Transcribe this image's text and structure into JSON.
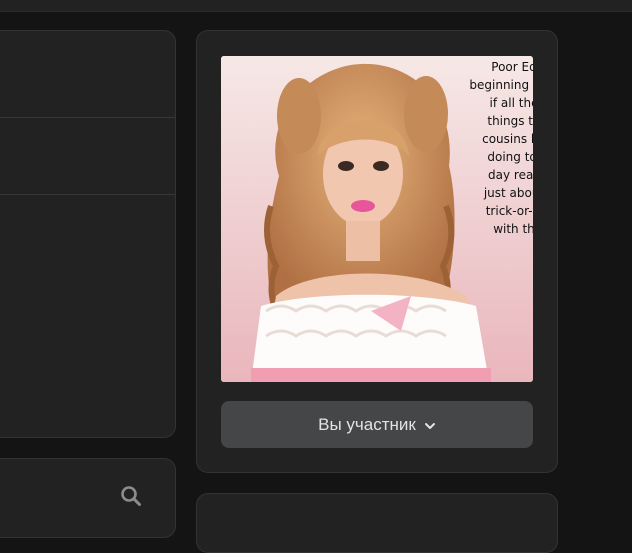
{
  "colors": {
    "background": "#141414",
    "card": "#222222",
    "button": "#454647",
    "text": "#e1e3e6"
  },
  "community": {
    "photo_caption": "Poor Ed\nbeginning to w\nif all the\nthings th\ncousins ha\ndoing to \nday reall\njust about\ntrick-or-tr\nwith th",
    "member_button_label": "Вы участник"
  },
  "icons": {
    "search": "search-icon",
    "dropdown": "chevron-down-icon"
  }
}
